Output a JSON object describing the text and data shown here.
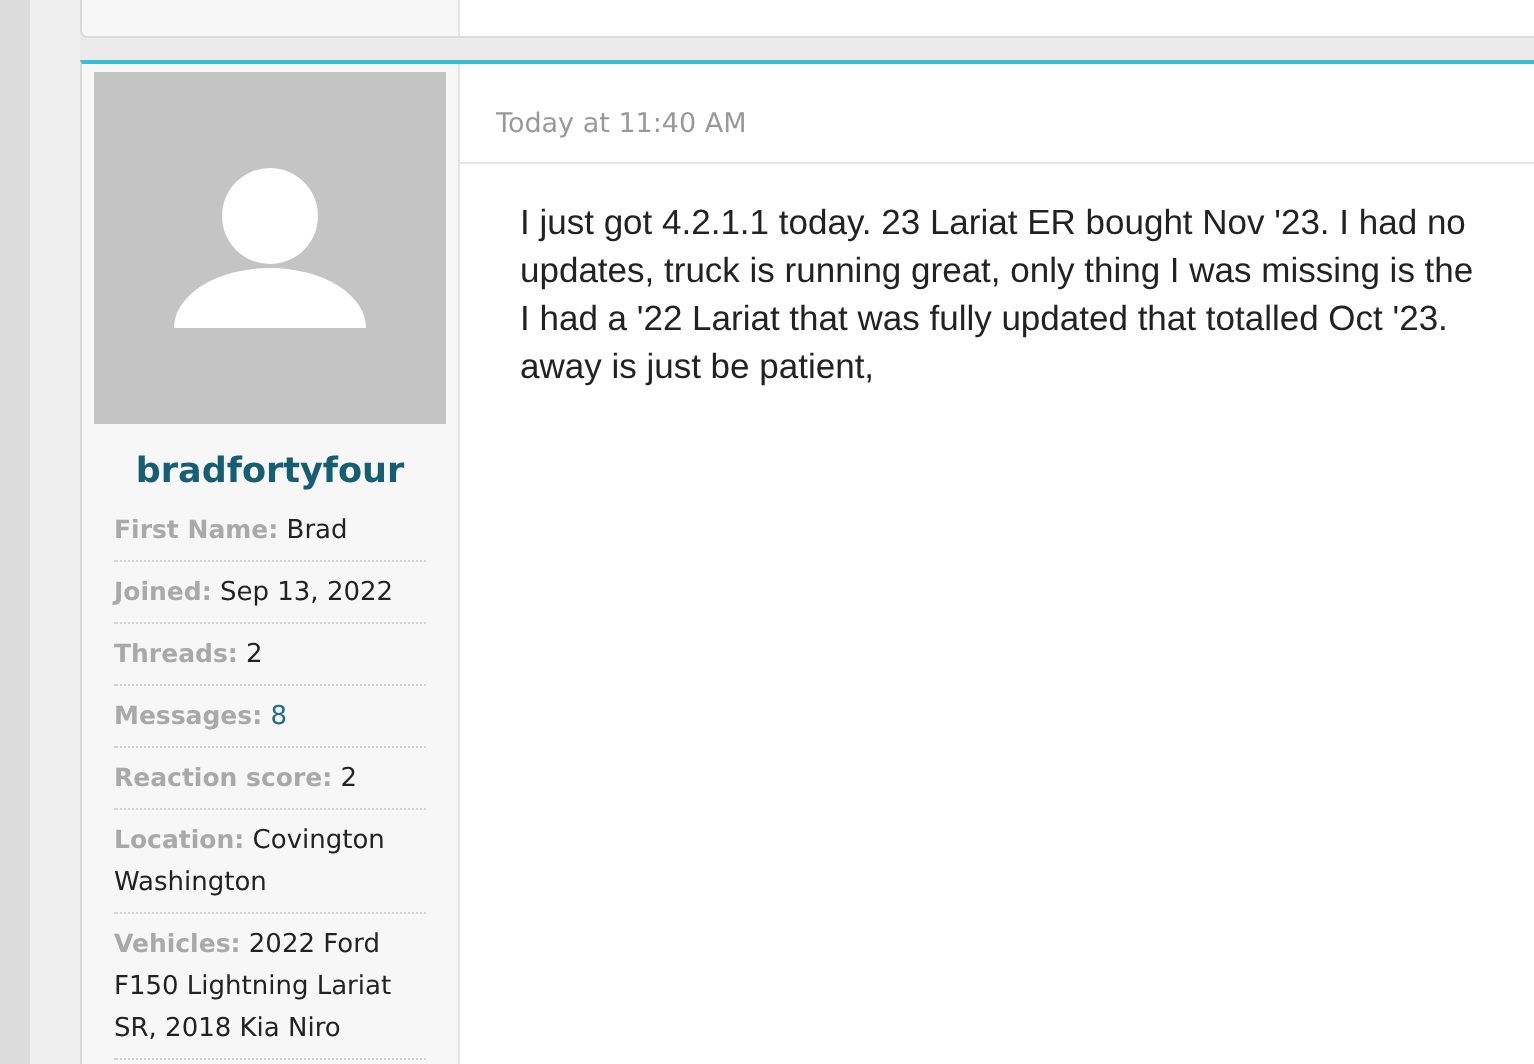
{
  "post": {
    "author": {
      "username": "bradfortyfour",
      "fields": [
        {
          "label": "First Name:",
          "value": "Brad",
          "link": false
        },
        {
          "label": "Joined:",
          "value": "Sep 13, 2022",
          "link": false
        },
        {
          "label": "Threads:",
          "value": "2",
          "link": false
        },
        {
          "label": "Messages:",
          "value": "8",
          "link": true
        },
        {
          "label": "Reaction score:",
          "value": "2",
          "link": false
        },
        {
          "label": "Location:",
          "value": "Covington Washington",
          "link": false
        },
        {
          "label": "Vehicles:",
          "value": "2022 Ford F150 Lightning Lariat SR, 2018 Kia Niro",
          "link": false
        }
      ]
    },
    "timestamp": "Today at 11:40 AM",
    "body_lines": [
      "I just got 4.2.1.1 today. 23 Lariat ER bought Nov '23. I had no",
      "updates, truck is running great, only thing I was missing is the",
      "I had a '22 Lariat that was fully updated that totalled Oct '23.",
      "away is just be patient,"
    ]
  }
}
